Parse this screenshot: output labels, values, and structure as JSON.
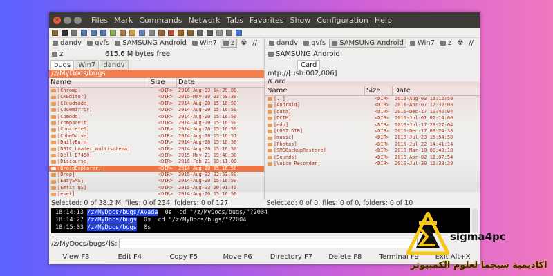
{
  "window": {
    "menu": [
      "Files",
      "Mark",
      "Commands",
      "Network",
      "Tabs",
      "Favorites",
      "Show",
      "Configuration",
      "Help"
    ]
  },
  "left_pane": {
    "drives": [
      "dandv",
      "gvfs",
      "SAMSUNG Android",
      "Win7",
      "z",
      "☢",
      "//"
    ],
    "active_drive": "z",
    "info_drive": "z",
    "info_free": "615.6 M bytes free",
    "tabs": [
      "bugs",
      "Win7",
      "dandv"
    ],
    "path": "/z/MyDocs/bugs",
    "columns": [
      "Name",
      "Size",
      "Date"
    ],
    "files": [
      {
        "name": "[Chrome]",
        "size": "<DIR>",
        "date": "2016-Aug-03 14:29:08"
      },
      {
        "name": "[CKEditor]",
        "size": "<DIR>",
        "date": "2015-May-30 23:59:39"
      },
      {
        "name": "[Cloudmade]",
        "size": "<DIR>",
        "date": "2014-Aug-20 15:16:50"
      },
      {
        "name": "[Codemirror]",
        "size": "<DIR>",
        "date": "2014-Aug-20 15:16:50"
      },
      {
        "name": "[Comodo]",
        "size": "<DIR>",
        "date": "2014-Aug-20 15:16:50"
      },
      {
        "name": "[compareit]",
        "size": "<DIR>",
        "date": "2014-Aug-20 15:16:50"
      },
      {
        "name": "[ConcreteS]",
        "size": "<DIR>",
        "date": "2014-Aug-20 15:16:50"
      },
      {
        "name": "[CubeDrive]",
        "size": "<DIR>",
        "date": "2014-Aug-20 15:16:51"
      },
      {
        "name": "[DailyBurn]",
        "size": "<DIR>",
        "date": "2014-Aug-20 15:16:50"
      },
      {
        "name": "[DBIC_Loader_multischema]",
        "size": "<DIR>",
        "date": "2014-Aug-20 15:16:50"
      },
      {
        "name": "[Dell E7450]",
        "size": "<DIR>",
        "date": "2015-May-21 19:40:38"
      },
      {
        "name": "[Discourse]",
        "size": "<DIR>",
        "date": "2016-Feb-21 18:11:08"
      },
      {
        "name": "[DroidExplorer]",
        "size": "<DIR>",
        "date": "2014-Aug-20 15:16:50"
      },
      {
        "name": "[Drop]",
        "size": "<DIR>",
        "date": "2015-Aug-02 02:53:50"
      },
      {
        "name": "[EasySMS]",
        "size": "<DIR>",
        "date": "2014-Aug-20 15:16:50"
      },
      {
        "name": "[Emfit QS]",
        "size": "<DIR>",
        "date": "2015-Aug-03 20:01:40"
      },
      {
        "name": "[eset]",
        "size": "<DIR>",
        "date": "2014-Aug-20 15:16:50"
      }
    ],
    "selected_index": 12,
    "status": "Selected: 0 of 38.2 M, files: 0 of 234, folders: 0 of 127"
  },
  "right_pane": {
    "drives": [
      "dandv",
      "gvfs",
      "SAMSUNG Android",
      "Win7",
      "z",
      "☢",
      "//"
    ],
    "active_drive": "SAMSUNG Android",
    "info_drive": "SAMSUNG Android",
    "tabs": [
      "Card"
    ],
    "path_top": "mtp://[usb:002,006]",
    "path": "/Card",
    "columns": [
      "Name",
      "Size",
      "Date"
    ],
    "files": [
      {
        "name": "[..]",
        "size": "<DIR>",
        "date": "2016-Aug-03 18:12:50"
      },
      {
        "name": "[Android]",
        "size": "<DIR>",
        "date": "2016-Apr-07 17:32:08"
      },
      {
        "name": "[data]",
        "size": "<DIR>",
        "date": "2015-Dec-17 19:46:04"
      },
      {
        "name": "[DCIM]",
        "size": "<DIR>",
        "date": "2016-Jul-01 02:14:00"
      },
      {
        "name": "[edu]",
        "size": "<DIR>",
        "date": "2016-Jul-17 23:27:04"
      },
      {
        "name": "[LOST.DIR]",
        "size": "<DIR>",
        "date": "2015-Dec-17 08:24:38"
      },
      {
        "name": "[music]",
        "size": "<DIR>",
        "date": "2016-Jul-23 15:54:50"
      },
      {
        "name": "[Photos]",
        "size": "<DIR>",
        "date": "2016-Jul-22 14:41:14"
      },
      {
        "name": "[SMSBackupRestore]",
        "size": "<DIR>",
        "date": "2016-Mar-18 00:49:10"
      },
      {
        "name": "[Sounds]",
        "size": "<DIR>",
        "date": "2016-Apr-02 12:07:54"
      },
      {
        "name": "[Voice Recorder]",
        "size": "<DIR>",
        "date": "2016-Jul-30 12:38:38"
      }
    ],
    "status": "Selected: 0 of 0, files: 0 of 0, folders: 0 of 10"
  },
  "terminal": {
    "lines": [
      {
        "time": "18:14:13",
        "path": "/z/MyDocs/bugs/Avada",
        "cmd": "  0s  cd \"/z/MyDocs/bugs/\"?2004"
      },
      {
        "time": "18:14:27",
        "path": "/z/MyDocs/bugs",
        "cmd": "  0s  cd \"/z/MyDocs/bugs/\"?2004"
      },
      {
        "time": "18:15:03",
        "path": "/z/MyDocs/bugs",
        "cmd": "  0s"
      }
    ]
  },
  "command_line": {
    "prompt": "/z/MyDocs/bugs/]$:"
  },
  "function_keys": [
    "View F3",
    "Edit F4",
    "Copy F5",
    "Move F6",
    "Directory F7",
    "Delete F8",
    "Terminal F9",
    "Exit Alt+X"
  ],
  "branding": {
    "name": "sigma4pc",
    "arabic": "اكاديمية سيجما لعلوم الكمبيوتر"
  }
}
